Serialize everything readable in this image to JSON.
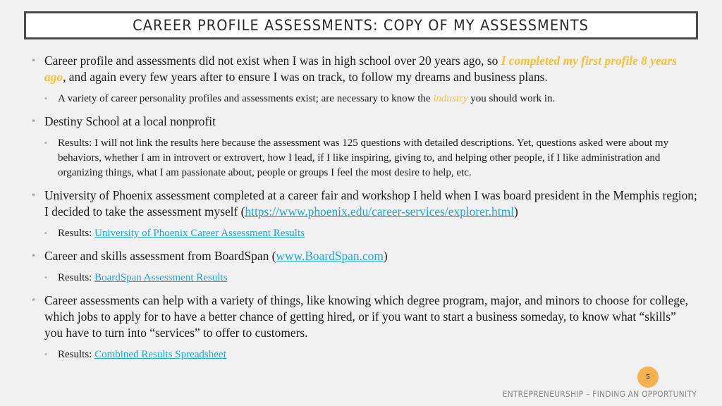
{
  "slide": {
    "title": "CAREER PROFILE ASSESSMENTS: COPY OF MY ASSESSMENTS",
    "page_number": "5",
    "footer": "ENTREPRENEURSHIP – FINDING AN OPPORTUNITY",
    "colors": {
      "highlight": "#f5c231",
      "link": "#1da7d8",
      "badge": "#f4b350"
    }
  },
  "bullets": {
    "b1": {
      "pre": "Career profile and assessments did not exist when I was in high school over 20 years ago, so ",
      "highlight": "I completed my first profile 8 years ago",
      "post": ", and again every few years after to ensure I was on track, to follow my dreams and business plans."
    },
    "b1_sub": {
      "pre": "A variety of career personality profiles and assessments exist; are necessary to know the ",
      "highlight": "industry",
      "post": " you should work in."
    },
    "b2": {
      "text": "Destiny School at a local nonprofit"
    },
    "b2_sub": {
      "text": "Results: I will not link the results here because the assessment was 125 questions with detailed descriptions.  Yet, questions asked were about my behaviors, whether I am in introvert or extrovert, how I lead, if I like inspiring, giving to, and helping other people, if I like administration and organizing things, what I am passionate about, people or groups I feel the most desire to help, etc."
    },
    "b3": {
      "pre": "University of Phoenix assessment completed at a career fair and workshop I held when I was board president in the Memphis region; I decided to take the assessment myself (",
      "link": "https://www.phoenix.edu/career-services/explorer.html",
      "post": ")"
    },
    "b3_sub": {
      "pre": "Results: ",
      "link": "University of Phoenix Career Assessment Results"
    },
    "b4": {
      "pre": "Career and skills assessment from BoardSpan (",
      "link": "www.BoardSpan.com",
      "post": ")"
    },
    "b4_sub": {
      "pre": "Results: ",
      "link": "BoardSpan Assessment Results"
    },
    "b5": {
      "text": "Career assessments can help with a variety of things, like knowing which degree program, major, and minors to choose for college, which jobs to apply for to have a better chance of getting hired, or if you want to start a business someday, to know what “skills” you have to turn into “services” to offer to customers."
    },
    "b5_sub": {
      "pre": "Results: ",
      "link": "Combined Results Spreadsheet"
    }
  }
}
